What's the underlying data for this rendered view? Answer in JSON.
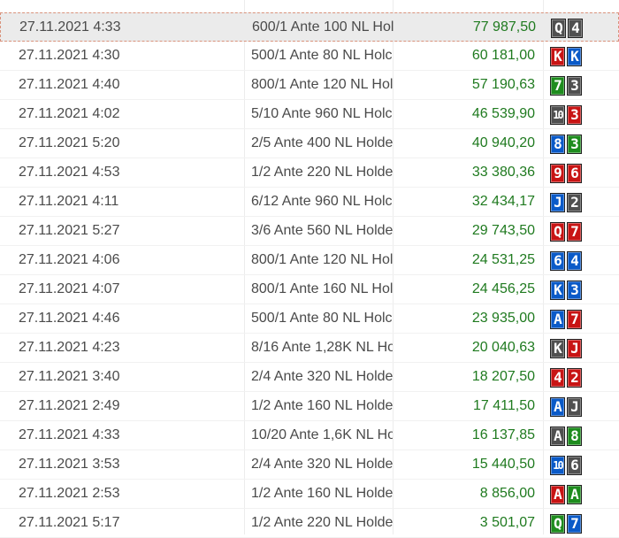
{
  "rows": [
    {
      "date": "27.11.2021 4:33",
      "game": "600/1 Ante 100 NL Hol",
      "amount": "77 987,50",
      "cards": [
        {
          "rank": "Q",
          "suit_color": "gray"
        },
        {
          "rank": "4",
          "suit_color": "gray"
        }
      ]
    },
    {
      "date": "27.11.2021 4:30",
      "game": "500/1 Ante 80 NL Holc",
      "amount": "60 181,00",
      "cards": [
        {
          "rank": "K",
          "suit_color": "red"
        },
        {
          "rank": "K",
          "suit_color": "blue"
        }
      ]
    },
    {
      "date": "27.11.2021 4:40",
      "game": "800/1 Ante 120 NL Hol",
      "amount": "57 190,63",
      "cards": [
        {
          "rank": "7",
          "suit_color": "green"
        },
        {
          "rank": "3",
          "suit_color": "gray"
        }
      ]
    },
    {
      "date": "27.11.2021 4:02",
      "game": "5/10 Ante 960 NL Holc",
      "amount": "46 539,90",
      "cards": [
        {
          "rank": "10",
          "suit_color": "gray"
        },
        {
          "rank": "3",
          "suit_color": "red"
        }
      ]
    },
    {
      "date": "27.11.2021 5:20",
      "game": "2/5 Ante 400 NL Holde",
      "amount": "40 940,20",
      "cards": [
        {
          "rank": "8",
          "suit_color": "blue"
        },
        {
          "rank": "3",
          "suit_color": "green"
        }
      ]
    },
    {
      "date": "27.11.2021 4:53",
      "game": "1/2 Ante 220 NL Holde",
      "amount": "33 380,36",
      "cards": [
        {
          "rank": "9",
          "suit_color": "red"
        },
        {
          "rank": "6",
          "suit_color": "red"
        }
      ]
    },
    {
      "date": "27.11.2021 4:11",
      "game": "6/12 Ante 960 NL Holc",
      "amount": "32 434,17",
      "cards": [
        {
          "rank": "J",
          "suit_color": "blue"
        },
        {
          "rank": "2",
          "suit_color": "gray"
        }
      ]
    },
    {
      "date": "27.11.2021 5:27",
      "game": "3/6 Ante 560 NL Holde",
      "amount": "29 743,50",
      "cards": [
        {
          "rank": "Q",
          "suit_color": "red"
        },
        {
          "rank": "7",
          "suit_color": "red"
        }
      ]
    },
    {
      "date": "27.11.2021 4:06",
      "game": "800/1 Ante 120 NL Hol",
      "amount": "24 531,25",
      "cards": [
        {
          "rank": "6",
          "suit_color": "blue"
        },
        {
          "rank": "4",
          "suit_color": "blue"
        }
      ]
    },
    {
      "date": "27.11.2021 4:07",
      "game": "800/1 Ante 160 NL Hol",
      "amount": "24 456,25",
      "cards": [
        {
          "rank": "K",
          "suit_color": "blue"
        },
        {
          "rank": "3",
          "suit_color": "blue"
        }
      ]
    },
    {
      "date": "27.11.2021 4:46",
      "game": "500/1 Ante 80 NL Holc",
      "amount": "23 935,00",
      "cards": [
        {
          "rank": "A",
          "suit_color": "blue"
        },
        {
          "rank": "7",
          "suit_color": "red"
        }
      ]
    },
    {
      "date": "27.11.2021 4:23",
      "game": "8/16 Ante 1,28K NL Ho",
      "amount": "20 040,63",
      "cards": [
        {
          "rank": "K",
          "suit_color": "gray"
        },
        {
          "rank": "J",
          "suit_color": "red"
        }
      ]
    },
    {
      "date": "27.11.2021 3:40",
      "game": "2/4 Ante 320 NL Holde",
      "amount": "18 207,50",
      "cards": [
        {
          "rank": "4",
          "suit_color": "red"
        },
        {
          "rank": "2",
          "suit_color": "red"
        }
      ]
    },
    {
      "date": "27.11.2021 2:49",
      "game": "1/2 Ante 160 NL Holde",
      "amount": "17 411,50",
      "cards": [
        {
          "rank": "A",
          "suit_color": "blue"
        },
        {
          "rank": "J",
          "suit_color": "gray"
        }
      ]
    },
    {
      "date": "27.11.2021 4:33",
      "game": "10/20 Ante 1,6K NL Ho",
      "amount": "16 137,85",
      "cards": [
        {
          "rank": "A",
          "suit_color": "gray"
        },
        {
          "rank": "8",
          "suit_color": "green"
        }
      ]
    },
    {
      "date": "27.11.2021 3:53",
      "game": "2/4 Ante 320 NL Holde",
      "amount": "15 440,50",
      "cards": [
        {
          "rank": "10",
          "suit_color": "blue"
        },
        {
          "rank": "6",
          "suit_color": "gray"
        }
      ]
    },
    {
      "date": "27.11.2021 2:53",
      "game": "1/2 Ante 160 NL Holde",
      "amount": "8 856,00",
      "cards": [
        {
          "rank": "A",
          "suit_color": "red"
        },
        {
          "rank": "A",
          "suit_color": "green"
        }
      ]
    },
    {
      "date": "27.11.2021 5:17",
      "game": "1/2 Ante 220 NL Holde",
      "amount": "3 501,07",
      "cards": [
        {
          "rank": "Q",
          "suit_color": "green"
        },
        {
          "rank": "7",
          "suit_color": "blue"
        }
      ]
    }
  ],
  "selected_row": 0,
  "colors": {
    "amount_text": "#1f7a1f",
    "selected_background": "#ebebeb",
    "selected_border": "#d9937c",
    "suit_gray": "#505050",
    "suit_red": "#c81414",
    "suit_blue": "#0a5ac8",
    "suit_green": "#1e8c1e"
  }
}
